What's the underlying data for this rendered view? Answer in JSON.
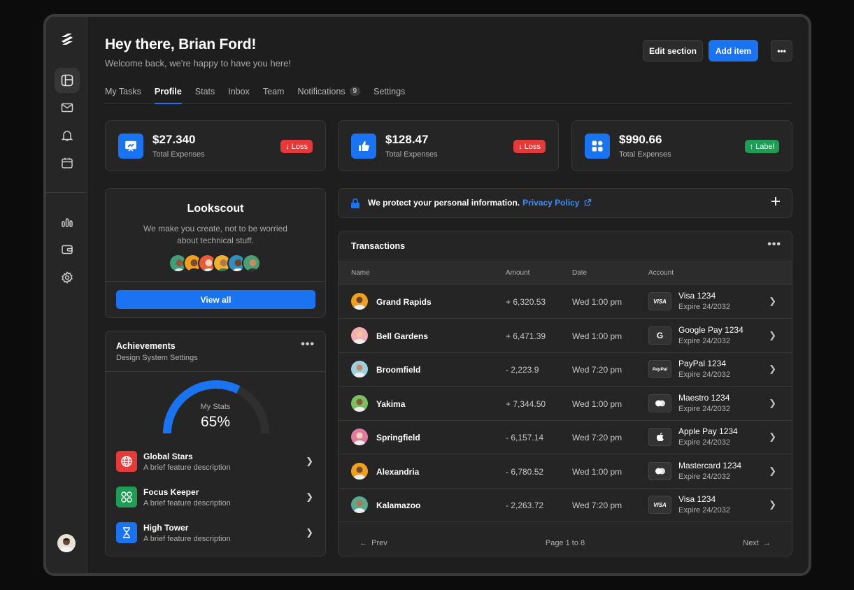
{
  "header": {
    "greeting": "Hey there, Brian Ford!",
    "subtitle": "Welcome back, we're happy to have you here!",
    "edit_label": "Edit section",
    "add_label": "Add item",
    "more_label": "•••"
  },
  "tabs": [
    {
      "label": "My Tasks"
    },
    {
      "label": "Profile"
    },
    {
      "label": "Stats"
    },
    {
      "label": "Inbox"
    },
    {
      "label": "Team"
    },
    {
      "label": "Notifications",
      "badge": "9"
    },
    {
      "label": "Settings"
    }
  ],
  "active_tab": "Profile",
  "stats": [
    {
      "value": "$27.340",
      "label": "Total Expenses",
      "pill": "Loss",
      "pill_arrow": "↓",
      "icon": "presentation-chart-icon"
    },
    {
      "value": "$128.47",
      "label": "Total Expenses",
      "pill": "Loss",
      "pill_arrow": "↓",
      "icon": "thumbs-up-icon"
    },
    {
      "value": "$990.66",
      "label": "Total Expenses",
      "pill": "Label",
      "pill_arrow": "↑",
      "icon": "grid-apps-icon"
    }
  ],
  "lookscout": {
    "title": "Lookscout",
    "desc": "We make you create, not to be worried about technical stuff.",
    "button": "View all"
  },
  "achievements": {
    "title": "Achievements",
    "subtitle": "Design System Settings",
    "gauge_label": "My Stats",
    "gauge_value": "65%",
    "gauge_fraction": 0.65,
    "items": [
      {
        "title": "Global Stars",
        "desc": "A brief feature description",
        "icon": "globe-icon",
        "color": "#e5393a"
      },
      {
        "title": "Focus Keeper",
        "desc": "A brief feature description",
        "icon": "circles-grid-icon",
        "color": "#1f9d55"
      },
      {
        "title": "High Tower",
        "desc": "A brief feature description",
        "icon": "hourglass-icon",
        "color": "#1a73f0"
      }
    ]
  },
  "privacy": {
    "text": "We protect your personal information.",
    "link": "Privacy Policy"
  },
  "transactions": {
    "title": "Transactions",
    "columns": [
      "Name",
      "Amount",
      "Date",
      "Account"
    ],
    "rows": [
      {
        "name": "Grand Rapids",
        "amount": "+ 6,320.53",
        "date": "Wed 1:00 pm",
        "account": "Visa 1234",
        "expire": "Expire 24/2032",
        "logo": "VISA"
      },
      {
        "name": "Bell Gardens",
        "amount": "+ 6,471.39",
        "date": "Wed 1:00 pm",
        "account": "Google Pay 1234",
        "expire": "Expire 24/2032",
        "logo": "G"
      },
      {
        "name": "Broomfield",
        "amount": "- 2,223.9",
        "date": "Wed 7:20 pm",
        "account": "PayPal 1234",
        "expire": "Expire 24/2032",
        "logo": "PayPal"
      },
      {
        "name": "Yakima",
        "amount": "+ 7,344.50",
        "date": "Wed 1:00 pm",
        "account": "Maestro 1234",
        "expire": "Expire 24/2032",
        "logo": "maestro"
      },
      {
        "name": "Springfield",
        "amount": "- 6,157.14",
        "date": "Wed 7:20 pm",
        "account": "Apple Pay 1234",
        "expire": "Expire 24/2032",
        "logo": "apple"
      },
      {
        "name": "Alexandria",
        "amount": "- 6,780.52",
        "date": "Wed 1:00 pm",
        "account": "Mastercard 1234",
        "expire": "Expire 24/2032",
        "logo": "mastercard"
      },
      {
        "name": "Kalamazoo",
        "amount": "- 2,263.72",
        "date": "Wed 7:20 pm",
        "account": "Visa 1234",
        "expire": "Expire 24/2032",
        "logo": "VISA"
      }
    ],
    "prev": "Prev",
    "page": "Page 1 to 8",
    "next": "Next"
  },
  "colors": {
    "accent": "#1a73f0",
    "loss": "#e5393a",
    "gain": "#1f9d55"
  }
}
